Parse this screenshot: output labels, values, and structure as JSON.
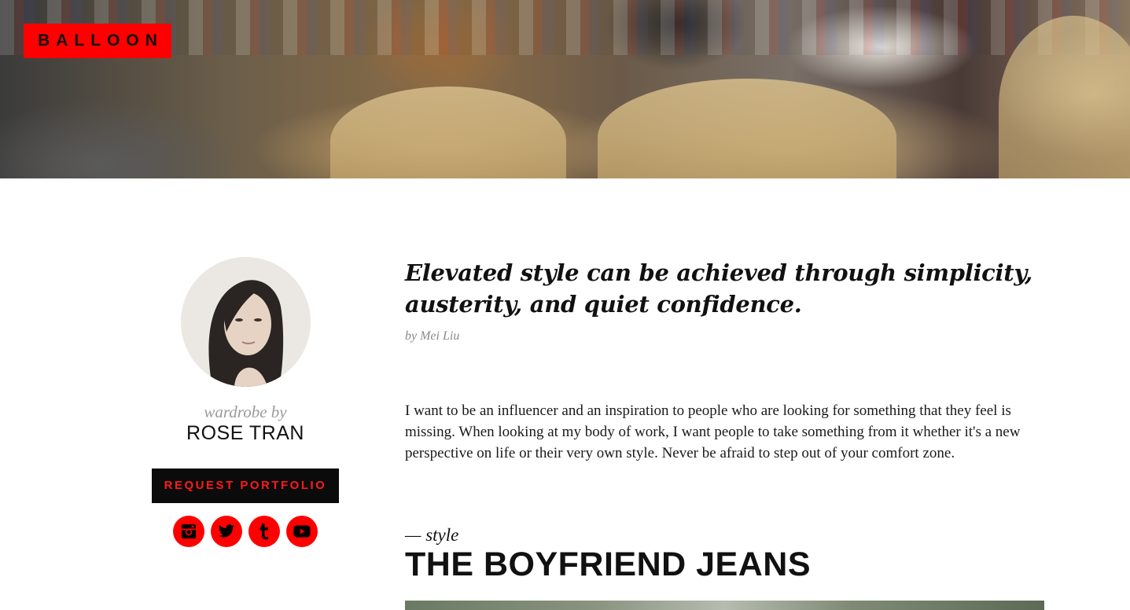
{
  "brand": {
    "logo_text": "BALLOON",
    "accent_color": "#ff0000",
    "dark_color": "#0b0b0b"
  },
  "hero": {
    "image": "fashion-store-bags-hats-photo"
  },
  "profile": {
    "avatar": "stylist-portrait-photo",
    "prefix": "wardrobe by",
    "name": "ROSE TRAN",
    "cta_label": "REQUEST PORTFOLIO",
    "socials": [
      {
        "icon": "instagram-icon"
      },
      {
        "icon": "twitter-icon"
      },
      {
        "icon": "tumblr-icon"
      },
      {
        "icon": "youtube-icon"
      }
    ]
  },
  "article": {
    "quote": "Elevated style can be achieved through simplicity, austerity, and quiet confidence.",
    "quote_author": "by Mei Liu",
    "intro": "I want to be an influencer and an inspiration to people who are looking for something that they feel is missing.  When looking at my body of work, I want people to take something from it whether it's a new perspective on life or their very own style.  Never be afraid to step out of your comfort zone.",
    "kicker": "— style",
    "section_title": "THE BOYFRIEND JEANS",
    "section_image": "outdoor-fashion-photo"
  }
}
